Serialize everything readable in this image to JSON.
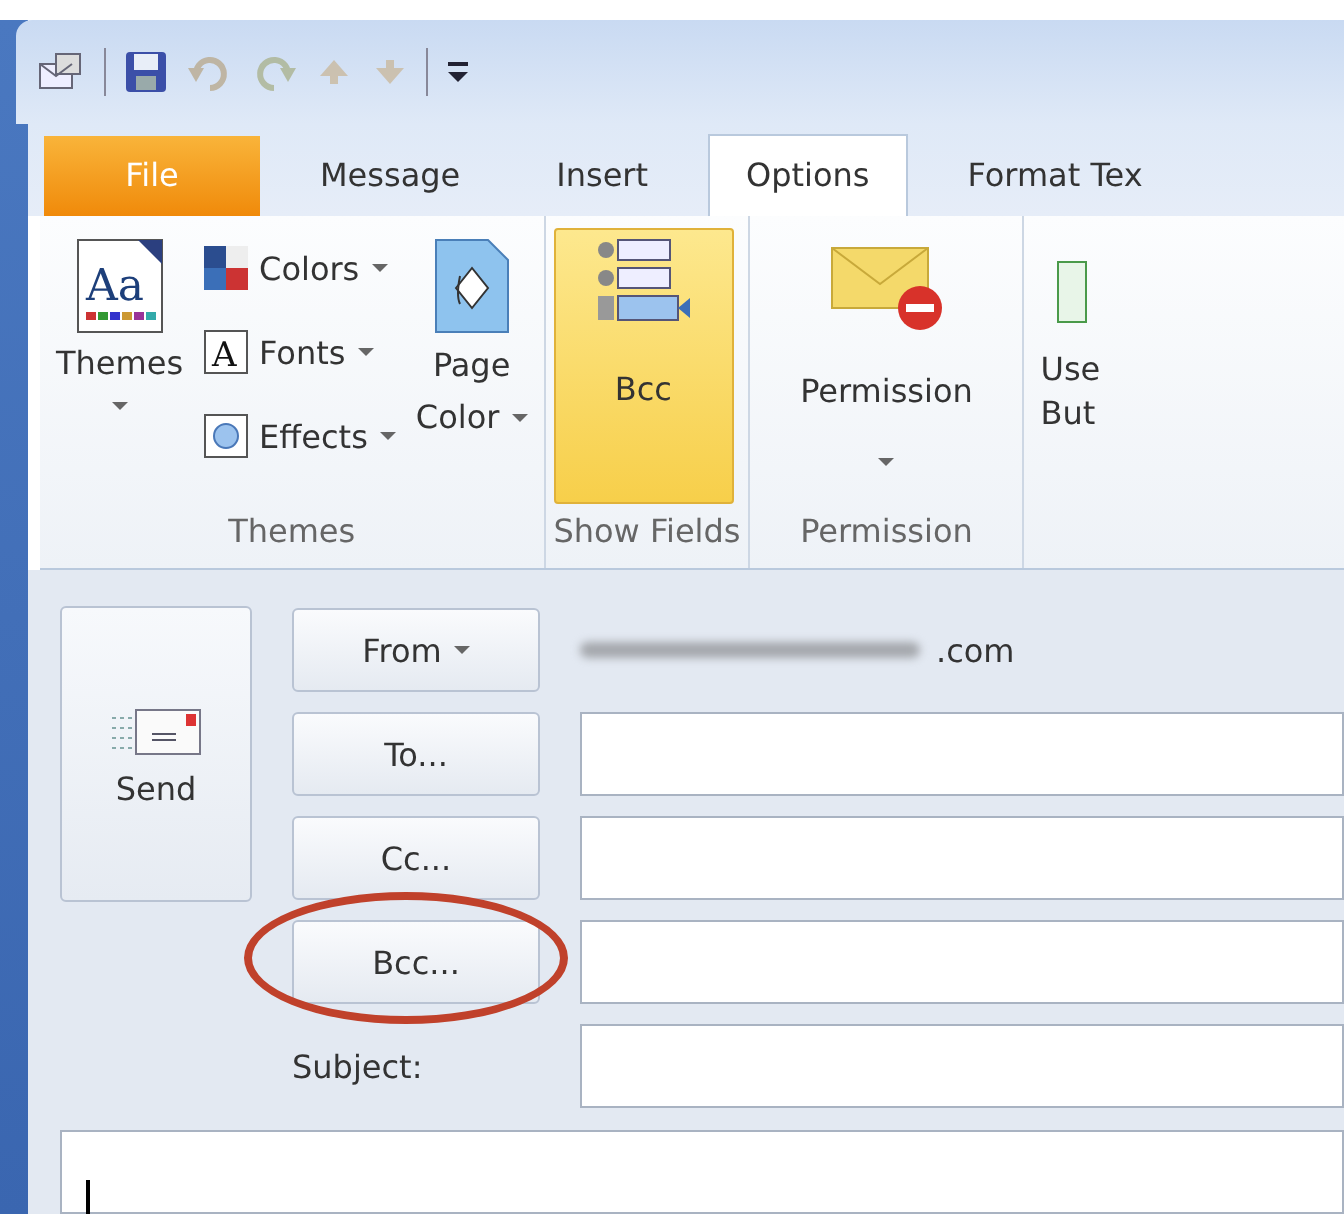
{
  "tabs": [
    {
      "label": "File",
      "kind": "backstage",
      "selected": false
    },
    {
      "label": "Message",
      "kind": "tab",
      "selected": false
    },
    {
      "label": "Insert",
      "kind": "tab",
      "selected": false
    },
    {
      "label": "Options",
      "kind": "tab",
      "selected": true
    },
    {
      "label": "Format Tex",
      "kind": "tab",
      "selected": false
    }
  ],
  "ribbon": {
    "themes_group": {
      "label": "Themes",
      "themes": {
        "label": "Themes",
        "icon_text": "Aa",
        "dropdown": true
      },
      "small": [
        {
          "label": "Colors",
          "dropdown": true
        },
        {
          "label": "Fonts",
          "icon_text": "A",
          "dropdown": true
        },
        {
          "label": "Effects",
          "dropdown": true
        }
      ],
      "page_color": {
        "lines": [
          "Page",
          "Color"
        ],
        "dropdown": true
      }
    },
    "show_fields": {
      "label": "Show Fields",
      "bcc": {
        "label": "Bcc",
        "selected": true
      }
    },
    "permission": {
      "label": "Permission",
      "button": {
        "label": "Permission",
        "dropdown": true
      }
    },
    "cut_button": {
      "lines": [
        "Use",
        "But"
      ]
    }
  },
  "compose": {
    "send": "Send",
    "from": {
      "label": "From",
      "dropdown": true,
      "address": ".com"
    },
    "recipients": [
      {
        "label": "To...",
        "circled": false
      },
      {
        "label": "Cc...",
        "circled": false
      },
      {
        "label": "Bcc...",
        "circled": true
      }
    ],
    "subject_label": "Subject:"
  }
}
